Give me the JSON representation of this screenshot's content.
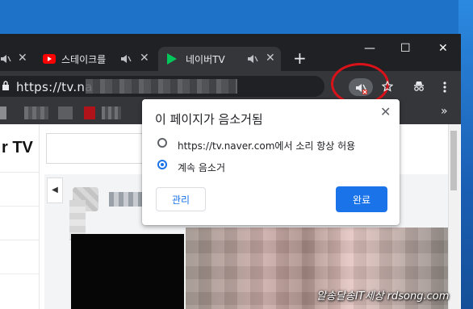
{
  "tabs": [
    {
      "label": "",
      "muted": true
    },
    {
      "label": "스테이크를",
      "muted": true,
      "favicon": "youtube-icon"
    },
    {
      "label": "네이버TV",
      "muted": true,
      "active": true,
      "favicon": "navertv-icon"
    }
  ],
  "new_tab_label": "+",
  "window_controls": {
    "minimize": "—",
    "maximize": "☐",
    "close": "✕"
  },
  "address": {
    "url": "https://tv.na"
  },
  "bookmarks_more": "»",
  "page": {
    "logo": "r TV"
  },
  "popup": {
    "title": "이 페이지가 음소거됨",
    "option_allow": "https://tv.naver.com에서 소리 항상 허용",
    "option_keep_muted": "계속 음소거",
    "selected": "option_keep_muted",
    "manage_button": "관리",
    "done_button": "완료",
    "close_glyph": "✕"
  },
  "watermark": "알송달송IT세상  rdsong.com",
  "colors": {
    "titlebar": "#202124",
    "toolbar": "#35363a",
    "accent": "#1a73e8",
    "highlight_circle": "#d9121a",
    "desktop": "#1e73c8"
  }
}
